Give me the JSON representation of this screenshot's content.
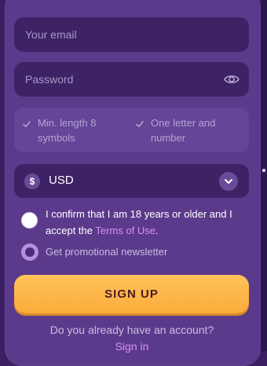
{
  "form": {
    "email": {
      "value": "",
      "placeholder": "Your email"
    },
    "password": {
      "value": "",
      "placeholder": "Password",
      "toggle_icon": "eye-icon"
    },
    "password_rules": [
      {
        "text": "Min. length 8 symbols",
        "icon": "check-icon"
      },
      {
        "text": "One letter and number",
        "icon": "check-icon"
      }
    ],
    "currency": {
      "symbol": "$",
      "value": "USD",
      "icon": "chevron-down-icon"
    },
    "age_confirm": {
      "text": "I confirm that I am 18 years or older and I accept the ",
      "link": "Terms of Use",
      "suffix": ".",
      "checked": false
    },
    "newsletter": {
      "label": "Get promotional newsletter",
      "checked": true
    },
    "submit_label": "SIGN UP",
    "have_account_text": "Do you already have an account?",
    "signin_label": "Sign in"
  },
  "colors": {
    "card": "#5b3a8b",
    "field": "#3e2266",
    "accent": "#ffc35a",
    "link": "#d98ef5"
  }
}
